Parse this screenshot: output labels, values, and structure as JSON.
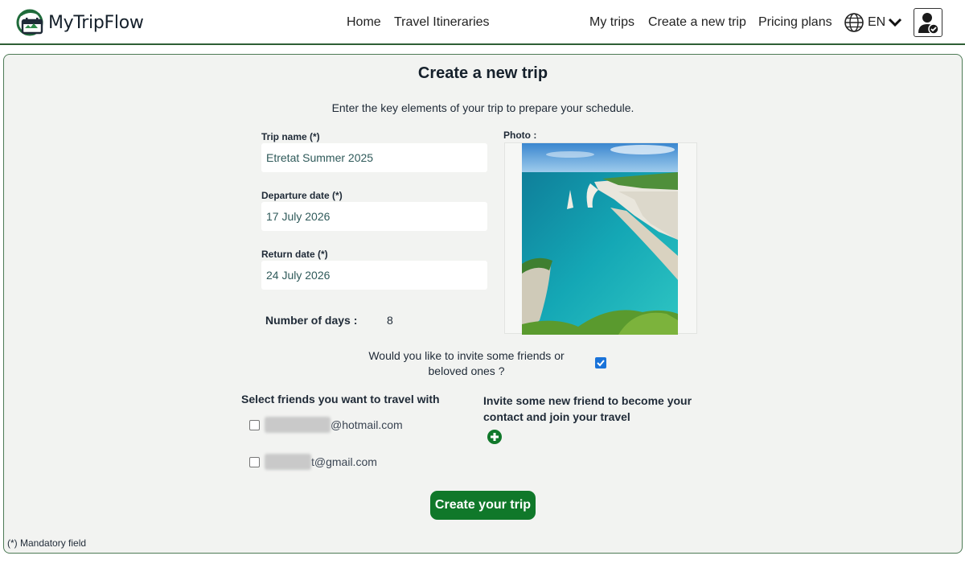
{
  "app": {
    "name": "MyTripFlow",
    "accent": "#10782a",
    "border_color": "#2e5e35"
  },
  "nav": {
    "home": "Home",
    "itineraries": "Travel Itineraries",
    "my_trips": "My trips",
    "create_trip": "Create a new trip",
    "pricing": "Pricing plans",
    "language": "EN",
    "language_icon": "globe-icon",
    "dropdown_icon": "chevron-down-icon",
    "user_icon": "user-check-icon"
  },
  "page": {
    "title": "Create a new trip",
    "subtitle": "Enter the key elements of your trip to prepare your schedule."
  },
  "form": {
    "trip_name": {
      "label": "Trip name (*)",
      "value": "Etretat Summer 2025"
    },
    "departure": {
      "label": "Departure date (*)",
      "value": "17 July 2026"
    },
    "return": {
      "label": "Return date (*)",
      "value": "24 July 2026"
    },
    "days": {
      "label": "Number of days :",
      "value": "8"
    },
    "photo": {
      "label": "Photo :"
    },
    "invite": {
      "question": "Would you like to invite some friends or beloved ones ?",
      "checked": true
    },
    "friends": {
      "title": "Select friends you want to travel with",
      "items": [
        {
          "email_visible": "@hotmail.com",
          "checked": false
        },
        {
          "email_visible": "t@gmail.com",
          "checked": false
        }
      ]
    },
    "new_friend": {
      "title": "Invite some new friend to become your contact and join your travel",
      "add_icon": "plus-circle-icon"
    },
    "submit_label": "Create your trip",
    "mandatory_note": "(*) Mandatory field"
  }
}
